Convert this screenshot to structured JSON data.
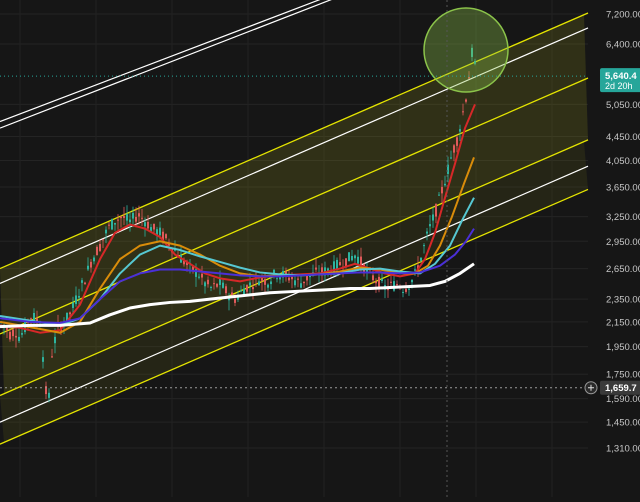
{
  "chart_data": {
    "type": "line",
    "title": "",
    "xlabel": "",
    "ylabel": "",
    "y_scale": "log",
    "ylim": [
      1300,
      7900
    ],
    "grid": true,
    "y_ticks": [
      {
        "value": 7200,
        "label": "7,200.00"
      },
      {
        "value": 6400,
        "label": "6,400.00"
      },
      {
        "value": 5050,
        "label": "5,050.00"
      },
      {
        "value": 4450,
        "label": "4,450.00"
      },
      {
        "value": 4050,
        "label": "4,050.00"
      },
      {
        "value": 3650,
        "label": "3,650.00"
      },
      {
        "value": 3250,
        "label": "3,250.00"
      },
      {
        "value": 2950,
        "label": "2,950.00"
      },
      {
        "value": 2650,
        "label": "2,650.00"
      },
      {
        "value": 2350,
        "label": "2,350.00"
      },
      {
        "value": 2150,
        "label": "2,150.00"
      },
      {
        "value": 1950,
        "label": "1,950.00"
      },
      {
        "value": 1750,
        "label": "1,750.00"
      },
      {
        "value": 1590,
        "label": "1,590.00"
      },
      {
        "value": 1450,
        "label": "1,450.00"
      },
      {
        "value": 1310,
        "label": "1,310.00"
      }
    ],
    "last_price": {
      "value": 5640.4,
      "label": "5,640.4",
      "countdown": "2d 20h",
      "color": "#26a69a"
    },
    "crosshair": {
      "value": 1659.7,
      "label": "1,659.7"
    },
    "series": [
      {
        "role": "price",
        "color": "#2db4a0",
        "points": [
          [
            0,
            2150
          ],
          [
            5,
            2120
          ],
          [
            10,
            2050
          ],
          [
            15,
            2080
          ],
          [
            20,
            2020
          ],
          [
            25,
            2100
          ],
          [
            30,
            2200
          ],
          [
            35,
            2180
          ],
          [
            40,
            2150
          ],
          [
            45,
            1700
          ],
          [
            48,
            1500
          ],
          [
            52,
            1900
          ],
          [
            58,
            2100
          ],
          [
            65,
            2150
          ],
          [
            72,
            2250
          ],
          [
            78,
            2400
          ],
          [
            85,
            2550
          ],
          [
            92,
            2750
          ],
          [
            100,
            2900
          ],
          [
            108,
            3100
          ],
          [
            115,
            3200
          ],
          [
            122,
            3250
          ],
          [
            130,
            3180
          ],
          [
            138,
            3280
          ],
          [
            145,
            3200
          ],
          [
            152,
            3100
          ],
          [
            160,
            3050
          ],
          [
            168,
            2950
          ],
          [
            175,
            2850
          ],
          [
            182,
            2750
          ],
          [
            190,
            2650
          ],
          [
            198,
            2600
          ],
          [
            205,
            2500
          ],
          [
            212,
            2450
          ],
          [
            220,
            2500
          ],
          [
            228,
            2400
          ],
          [
            236,
            2350
          ],
          [
            244,
            2450
          ],
          [
            252,
            2500
          ],
          [
            260,
            2550
          ],
          [
            268,
            2520
          ],
          [
            276,
            2600
          ],
          [
            284,
            2580
          ],
          [
            292,
            2550
          ],
          [
            300,
            2500
          ],
          [
            308,
            2560
          ],
          [
            316,
            2600
          ],
          [
            324,
            2620
          ],
          [
            332,
            2650
          ],
          [
            340,
            2700
          ],
          [
            348,
            2750
          ],
          [
            356,
            2800
          ],
          [
            362,
            2700
          ],
          [
            368,
            2600
          ],
          [
            374,
            2550
          ],
          [
            380,
            2500
          ],
          [
            386,
            2450
          ],
          [
            392,
            2480
          ],
          [
            398,
            2500
          ],
          [
            404,
            2450
          ],
          [
            410,
            2500
          ],
          [
            416,
            2600
          ],
          [
            422,
            2800
          ],
          [
            428,
            3050
          ],
          [
            434,
            3250
          ],
          [
            440,
            3500
          ],
          [
            446,
            3800
          ],
          [
            452,
            4150
          ],
          [
            458,
            4450
          ],
          [
            462,
            4800
          ],
          [
            466,
            5200
          ],
          [
            470,
            5800
          ],
          [
            473,
            6350
          ],
          [
            476,
            5640
          ]
        ]
      },
      {
        "role": "ma-red",
        "color": "#d62828",
        "points": [
          [
            0,
            2120
          ],
          [
            20,
            2100
          ],
          [
            40,
            2060
          ],
          [
            60,
            2080
          ],
          [
            80,
            2300
          ],
          [
            100,
            2750
          ],
          [
            115,
            3050
          ],
          [
            130,
            3150
          ],
          [
            145,
            3100
          ],
          [
            160,
            3000
          ],
          [
            175,
            2800
          ],
          [
            190,
            2700
          ],
          [
            205,
            2600
          ],
          [
            220,
            2550
          ],
          [
            240,
            2520
          ],
          [
            260,
            2560
          ],
          [
            280,
            2580
          ],
          [
            300,
            2590
          ],
          [
            320,
            2600
          ],
          [
            340,
            2650
          ],
          [
            355,
            2700
          ],
          [
            370,
            2650
          ],
          [
            385,
            2600
          ],
          [
            400,
            2570
          ],
          [
            415,
            2600
          ],
          [
            425,
            2750
          ],
          [
            435,
            3050
          ],
          [
            445,
            3500
          ],
          [
            455,
            4000
          ],
          [
            465,
            4600
          ],
          [
            475,
            5050
          ]
        ]
      },
      {
        "role": "ma-orange",
        "color": "#d98c0a",
        "points": [
          [
            0,
            2150
          ],
          [
            20,
            2120
          ],
          [
            40,
            2090
          ],
          [
            60,
            2060
          ],
          [
            80,
            2150
          ],
          [
            100,
            2450
          ],
          [
            120,
            2750
          ],
          [
            140,
            2900
          ],
          [
            160,
            2950
          ],
          [
            180,
            2900
          ],
          [
            200,
            2800
          ],
          [
            220,
            2680
          ],
          [
            240,
            2600
          ],
          [
            260,
            2570
          ],
          [
            280,
            2580
          ],
          [
            300,
            2580
          ],
          [
            320,
            2590
          ],
          [
            340,
            2620
          ],
          [
            360,
            2660
          ],
          [
            380,
            2640
          ],
          [
            400,
            2600
          ],
          [
            415,
            2600
          ],
          [
            428,
            2680
          ],
          [
            440,
            2900
          ],
          [
            452,
            3250
          ],
          [
            464,
            3700
          ],
          [
            474,
            4100
          ]
        ]
      },
      {
        "role": "ma-cyan",
        "color": "#56c8d2",
        "points": [
          [
            0,
            2200
          ],
          [
            30,
            2160
          ],
          [
            60,
            2120
          ],
          [
            80,
            2180
          ],
          [
            100,
            2350
          ],
          [
            120,
            2600
          ],
          [
            140,
            2800
          ],
          [
            160,
            2900
          ],
          [
            180,
            2850
          ],
          [
            200,
            2780
          ],
          [
            220,
            2720
          ],
          [
            240,
            2660
          ],
          [
            260,
            2610
          ],
          [
            280,
            2590
          ],
          [
            300,
            2580
          ],
          [
            320,
            2590
          ],
          [
            340,
            2600
          ],
          [
            360,
            2640
          ],
          [
            380,
            2650
          ],
          [
            400,
            2620
          ],
          [
            420,
            2600
          ],
          [
            435,
            2700
          ],
          [
            450,
            2900
          ],
          [
            462,
            3200
          ],
          [
            474,
            3500
          ]
        ]
      },
      {
        "role": "ma-purple",
        "color": "#4a2fd8",
        "points": [
          [
            0,
            2180
          ],
          [
            30,
            2150
          ],
          [
            60,
            2140
          ],
          [
            80,
            2180
          ],
          [
            100,
            2350
          ],
          [
            120,
            2520
          ],
          [
            140,
            2600
          ],
          [
            160,
            2640
          ],
          [
            180,
            2640
          ],
          [
            200,
            2620
          ],
          [
            220,
            2600
          ],
          [
            240,
            2580
          ],
          [
            260,
            2570
          ],
          [
            280,
            2570
          ],
          [
            300,
            2580
          ],
          [
            320,
            2590
          ],
          [
            340,
            2600
          ],
          [
            360,
            2610
          ],
          [
            380,
            2610
          ],
          [
            400,
            2600
          ],
          [
            420,
            2610
          ],
          [
            440,
            2680
          ],
          [
            455,
            2800
          ],
          [
            466,
            2950
          ],
          [
            474,
            3100
          ]
        ]
      },
      {
        "role": "ma-white",
        "color": "#ffffff",
        "points": [
          [
            0,
            2110
          ],
          [
            30,
            2120
          ],
          [
            60,
            2120
          ],
          [
            90,
            2140
          ],
          [
            110,
            2210
          ],
          [
            130,
            2270
          ],
          [
            150,
            2300
          ],
          [
            170,
            2320
          ],
          [
            190,
            2330
          ],
          [
            210,
            2350
          ],
          [
            230,
            2370
          ],
          [
            250,
            2390
          ],
          [
            270,
            2410
          ],
          [
            290,
            2420
          ],
          [
            310,
            2430
          ],
          [
            330,
            2440
          ],
          [
            350,
            2450
          ],
          [
            370,
            2450
          ],
          [
            390,
            2460
          ],
          [
            410,
            2470
          ],
          [
            430,
            2480
          ],
          [
            445,
            2520
          ],
          [
            460,
            2600
          ],
          [
            474,
            2700
          ]
        ]
      }
    ],
    "channels": {
      "yellow": {
        "color": "#e5e500",
        "fill": "rgba(150,150,40,0.25)",
        "lines": [
          [
            [
              0,
              2650
            ],
            [
              640,
              7900
            ]
          ],
          [
            [
              0,
              2050
            ],
            [
              640,
              6120
            ]
          ],
          [
            [
              0,
              1610
            ],
            [
              640,
              4800
            ]
          ],
          [
            [
              0,
              1330
            ],
            [
              640,
              3950
            ]
          ]
        ]
      },
      "white": {
        "color": "#ffffff",
        "lines": [
          [
            [
              0,
              2500
            ],
            [
              640,
              7450
            ]
          ],
          [
            [
              0,
              1450
            ],
            [
              640,
              4330
            ]
          ],
          [
            [
              0,
              4720
            ],
            [
              344,
              7900
            ]
          ],
          [
            [
              0,
              4600
            ],
            [
              355,
              7900
            ]
          ]
        ]
      }
    },
    "annotations": [
      {
        "type": "circle",
        "color": "#8bc34a",
        "fill": "rgba(139,195,74,0.35)",
        "cx_index": 466,
        "cy_value": 6250
      }
    ]
  }
}
